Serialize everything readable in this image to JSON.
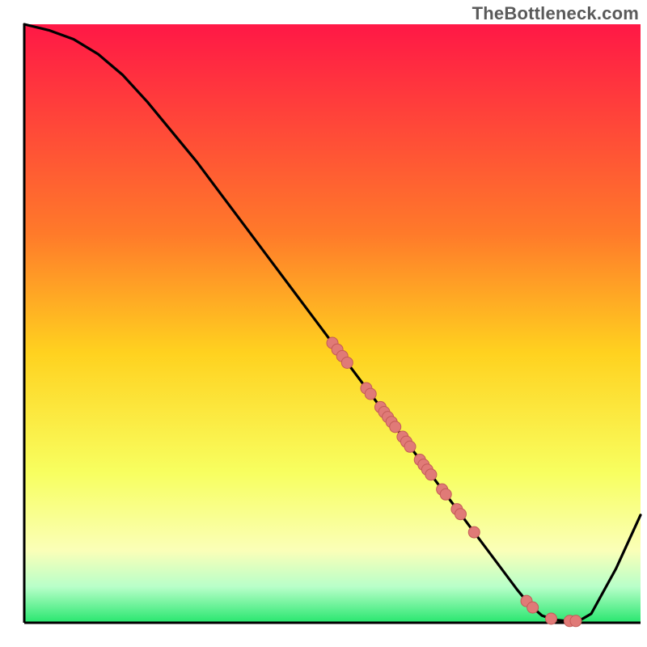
{
  "watermark": "TheBottleneck.com",
  "colors": {
    "gradient_top": "#ff1846",
    "gradient_mid_upper": "#ff7a2a",
    "gradient_mid": "#ffd21f",
    "gradient_lower": "#f8ff60",
    "gradient_cream": "#faffb8",
    "gradient_mint": "#b8ffc9",
    "gradient_green": "#27e66e",
    "axis": "#000000",
    "curve": "#000000",
    "dot_fill": "#e07a77",
    "dot_stroke": "#c45b58"
  },
  "chart_data": {
    "type": "line",
    "title": "",
    "xlabel": "",
    "ylabel": "",
    "xlim": [
      0,
      100
    ],
    "ylim": [
      0,
      100
    ],
    "curve": {
      "x": [
        0,
        4,
        8,
        12,
        16,
        20,
        24,
        28,
        32,
        36,
        40,
        44,
        48,
        52,
        56,
        60,
        64,
        68,
        72,
        76,
        80,
        82,
        84,
        86,
        88,
        90,
        92,
        96,
        100
      ],
      "y": [
        100,
        99,
        97.5,
        95,
        91.5,
        87,
        82,
        77,
        71.5,
        66,
        60.5,
        55,
        49.5,
        44,
        38.5,
        33,
        27.5,
        22,
        16.5,
        11,
        5.5,
        3,
        1.2,
        0.5,
        0.3,
        0.3,
        1.5,
        9,
        18
      ]
    },
    "scatter_on_curve_x": [
      50,
      50.8,
      51.6,
      52.4,
      55.5,
      56.2,
      57.8,
      58.4,
      59.0,
      59.6,
      60.2,
      61.4,
      62.0,
      62.6,
      64.2,
      64.8,
      65.4,
      66.0,
      67.8,
      68.4,
      70.2,
      70.8,
      73.0,
      81.5,
      82.5,
      85.5,
      88.5,
      89.5
    ]
  }
}
